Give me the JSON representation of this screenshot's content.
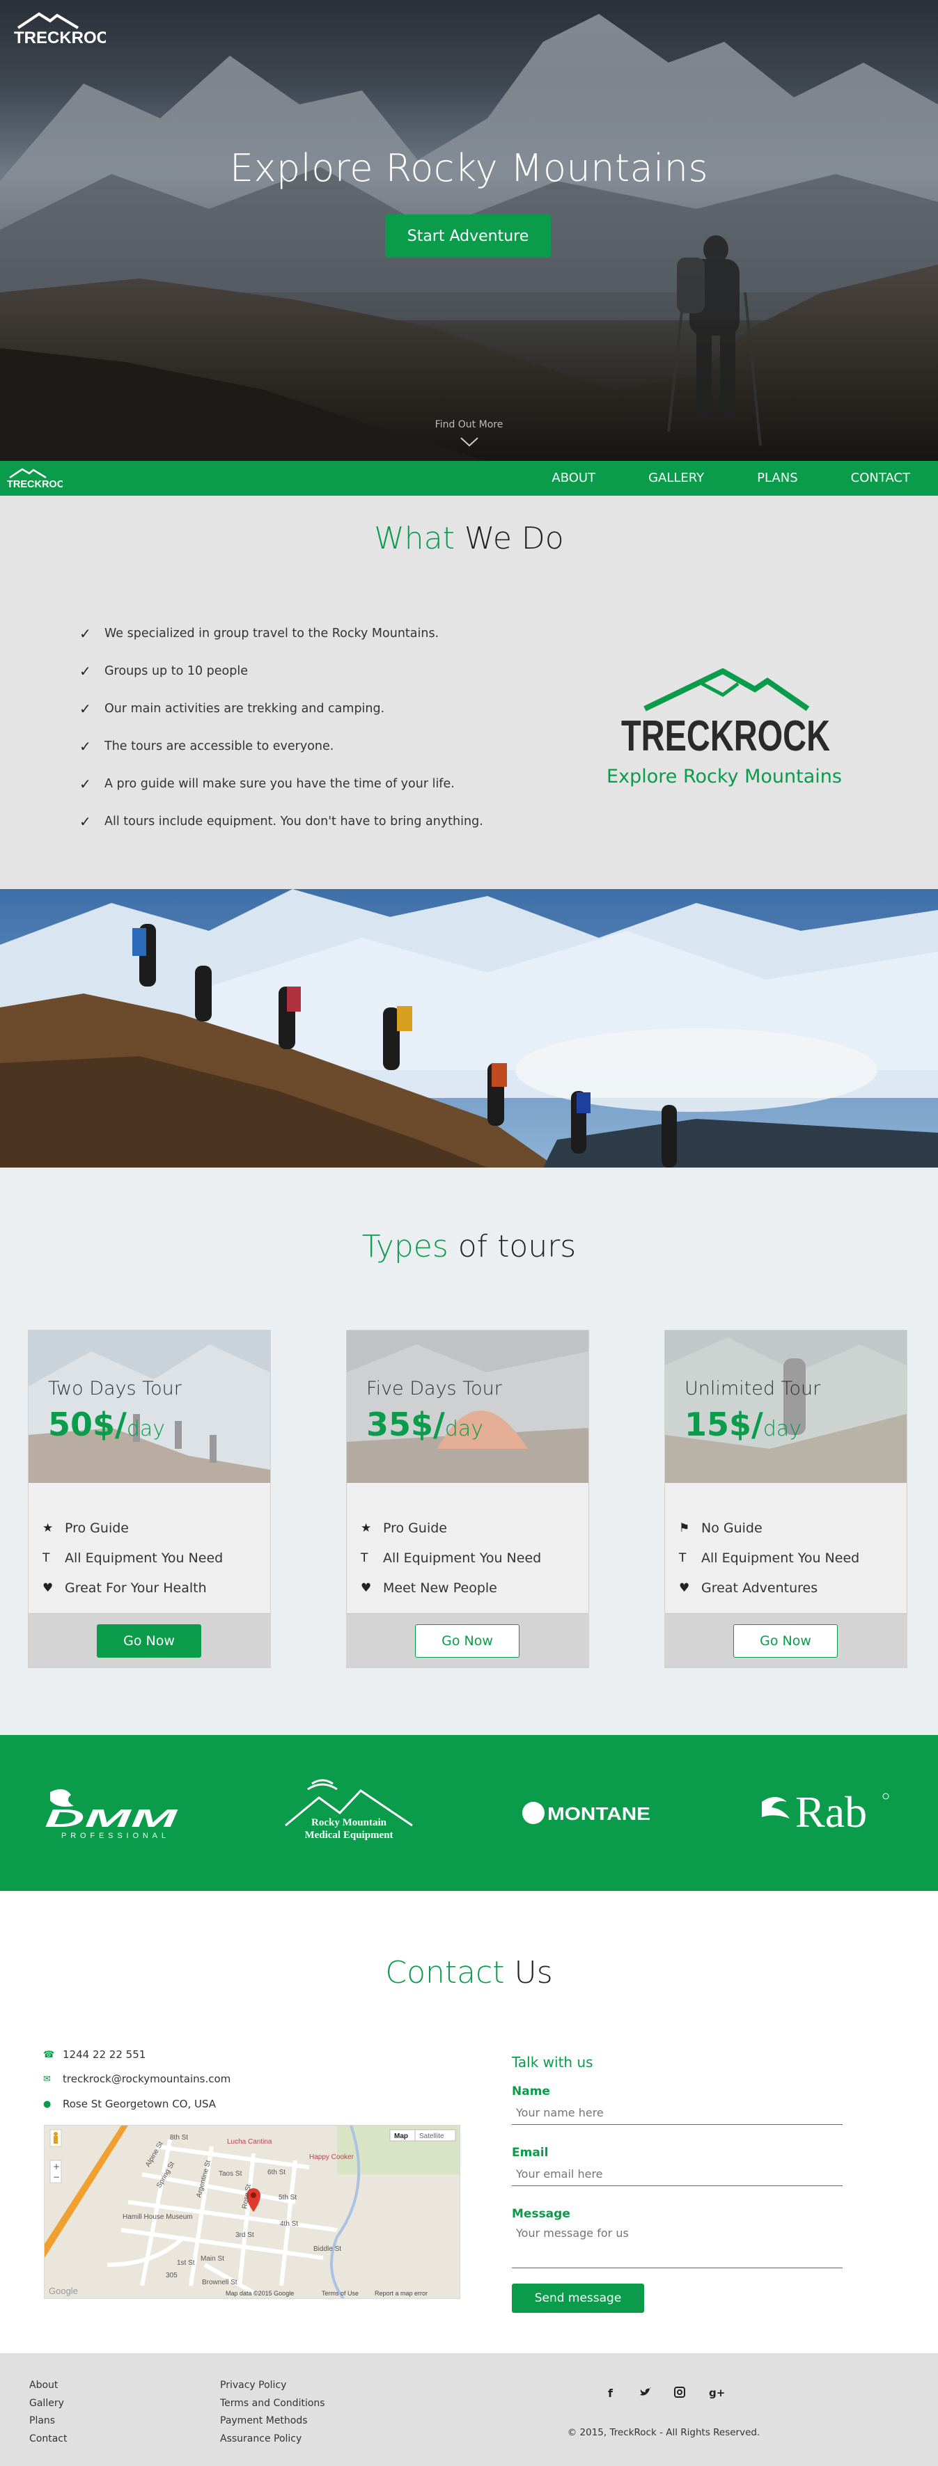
{
  "brand": {
    "logo_text": "TRECKROCK",
    "tagline": "Explore Rocky Mountains"
  },
  "hero": {
    "title": "Explore Rocky Mountains",
    "cta": "Start Adventure",
    "find_more": "Find Out More"
  },
  "nav": {
    "items": [
      "ABOUT",
      "GALLERY",
      "PLANS",
      "CONTACT"
    ]
  },
  "what": {
    "title_accent": "What",
    "title_rest": " We Do",
    "items": [
      "We specialized in group travel to the Rocky Mountains.",
      "Groups up to 10 people",
      "Our main activities are trekking and camping.",
      "The tours are accessible to everyone.",
      "A pro guide will make sure you have the time of your life.",
      "All tours include equipment. You don't have to bring anything."
    ]
  },
  "tours": {
    "title_accent": "Types",
    "title_rest": " of tours",
    "cards": [
      {
        "name": "Two Days Tour",
        "price": "50$/",
        "unit": "day",
        "features": [
          {
            "icon": "star-icon",
            "text": "Pro Guide"
          },
          {
            "icon": "equipment-icon",
            "text": "All Equipment You Need"
          },
          {
            "icon": "heart-icon",
            "text": "Great For Your Health"
          }
        ],
        "button": "Go Now"
      },
      {
        "name": "Five Days Tour",
        "price": "35$/",
        "unit": "day",
        "features": [
          {
            "icon": "star-icon",
            "text": "Pro Guide"
          },
          {
            "icon": "equipment-icon",
            "text": "All Equipment You Need"
          },
          {
            "icon": "heart-icon",
            "text": "Meet New People"
          }
        ],
        "button": "Go Now"
      },
      {
        "name": "Unlimited Tour",
        "price": "15$/",
        "unit": "day",
        "features": [
          {
            "icon": "flag-icon",
            "text": "No Guide"
          },
          {
            "icon": "equipment-icon",
            "text": "All Equipment You Need"
          },
          {
            "icon": "heart-icon",
            "text": "Great Adventures"
          }
        ],
        "button": "Go Now"
      }
    ]
  },
  "sponsors": {
    "dmm": "DMM",
    "dmm_sub": "PROFESSIONAL",
    "rme_line1": "Rocky Mountain",
    "rme_line2": "Medical Equipment",
    "montane": "MONTANE",
    "rab": "Rab"
  },
  "contact": {
    "title_accent": "Contact",
    "title_rest": " Us",
    "phone": "1244 22 22 551",
    "email": "treckrock@rockymountains.com",
    "address": "Rose St Georgetown CO, USA",
    "map": {
      "map_btn": "Map",
      "satellite_btn": "Satellite",
      "labels": [
        "Lucha Cantina",
        "Happy Cooker",
        "Hamill House Museum",
        "Alpine St",
        "Taos St",
        "6th St",
        "5th St",
        "4th St",
        "3rd St",
        "Rose St",
        "Argentine St",
        "Spring St",
        "1st St",
        "Main St",
        "8th St",
        "Biddle St",
        "Brownell St"
      ],
      "road_num": "305",
      "attribution": "Map data ©2015 Google",
      "terms": "Terms of Use",
      "report": "Report a map error",
      "google": "Google"
    },
    "form": {
      "heading": "Talk with us",
      "name_label": "Name",
      "name_placeholder": "Your name here",
      "email_label": "Email",
      "email_placeholder": "Your email here",
      "message_label": "Message",
      "message_placeholder": "Your message for us",
      "send": "Send message"
    }
  },
  "footer": {
    "col1": [
      "About",
      "Gallery",
      "Plans",
      "Contact"
    ],
    "col2": [
      "Privacy Policy",
      "Terms and Conditions",
      "Payment Methods",
      "Assurance Policy"
    ],
    "social": [
      "f",
      "t",
      "ig",
      "g+"
    ],
    "copyright": "© 2015, TreckRock - All Rights Reserved."
  },
  "colors": {
    "accent": "#0a9b4b",
    "section_gray": "#e4e4e4",
    "footer_gray": "#e0e0e0"
  }
}
